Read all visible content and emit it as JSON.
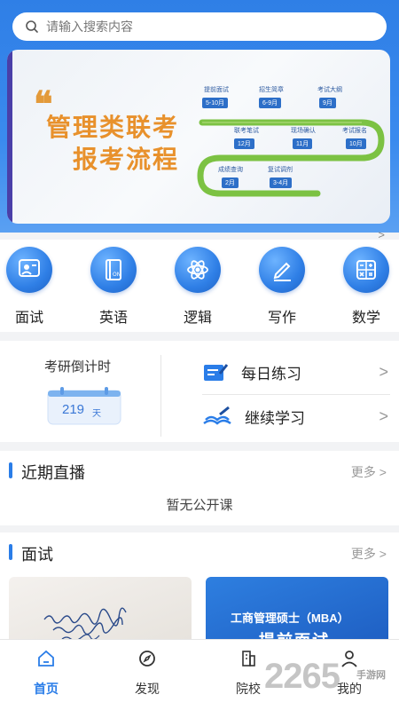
{
  "search": {
    "placeholder": "请输入搜索内容"
  },
  "banner": {
    "title_line1": "管理类联考",
    "title_line2": "报考流程",
    "steps": [
      {
        "label": "提前面试",
        "month": "5-10月"
      },
      {
        "label": "招生简章",
        "month": "6-9月"
      },
      {
        "label": "考试大纲",
        "month": "9月"
      },
      {
        "label": "联考笔试",
        "month": "12月"
      },
      {
        "label": "现场确认",
        "month": "11月"
      },
      {
        "label": "考试报名",
        "month": "10月"
      },
      {
        "label": "成绩查询",
        "month": "2月"
      },
      {
        "label": "复试调剂",
        "month": "3-4月"
      }
    ],
    "page_count": 3,
    "active_page": 2
  },
  "more_arrow": ">",
  "categories": [
    {
      "label": "面试",
      "icon": "interview-icon"
    },
    {
      "label": "英语",
      "icon": "book-icon"
    },
    {
      "label": "逻辑",
      "icon": "atom-icon"
    },
    {
      "label": "写作",
      "icon": "pen-icon"
    },
    {
      "label": "数学",
      "icon": "calculator-icon"
    }
  ],
  "countdown": {
    "title": "考研倒计时",
    "days": "219",
    "unit": "天"
  },
  "tasks": [
    {
      "label": "每日练习",
      "arrow": ">"
    },
    {
      "label": "继续学习",
      "arrow": ">"
    }
  ],
  "live": {
    "title": "近期直播",
    "more": "更多 >",
    "empty": "暂无公开课"
  },
  "interview": {
    "title": "面试",
    "more": "更多 >",
    "card2_line1": "工商管理硕士（MBA）",
    "card2_line2": "提前面试"
  },
  "tabs": [
    {
      "label": "首页",
      "icon": "home-icon"
    },
    {
      "label": "发现",
      "icon": "compass-icon"
    },
    {
      "label": "院校",
      "icon": "building-icon"
    },
    {
      "label": "我的",
      "icon": "user-icon"
    }
  ],
  "watermark": {
    "main": "2265",
    "sub": "手游网"
  },
  "colors": {
    "primary": "#2a7de8",
    "banner_orange": "#e8912c"
  }
}
